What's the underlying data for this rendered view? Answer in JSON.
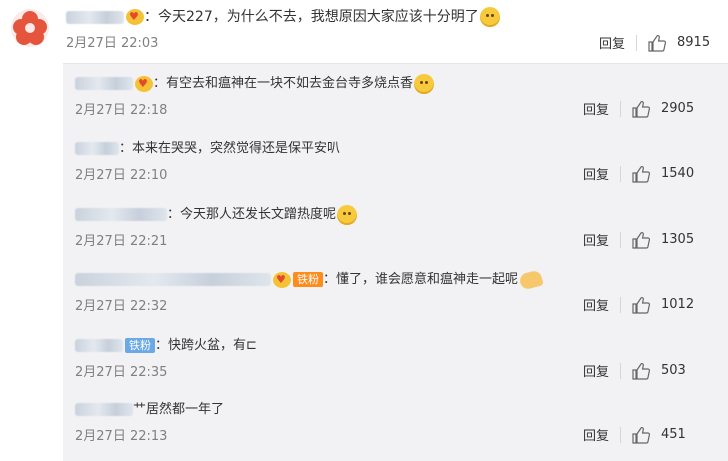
{
  "main_comment": {
    "text": "：今天227，为什么不去，我想原因大家应该十分明了",
    "time": "2月27日 22:03",
    "reply_label": "回复",
    "likes": "8915"
  },
  "replies": [
    {
      "text": "：有空去和瘟神在一块不如去金台寺多烧点香",
      "time": "2月27日 22:18",
      "reply_label": "回复",
      "likes": "2905"
    },
    {
      "text": "：本来在哭哭，突然觉得还是保平安叭",
      "time": "2月27日 22:10",
      "reply_label": "回复",
      "likes": "1540"
    },
    {
      "text": "：今天那人还发长文蹭热度呢",
      "time": "2月27日 22:21",
      "reply_label": "回复",
      "likes": "1305"
    },
    {
      "badge": "铁粉",
      "text": "：懂了，谁会愿意和瘟神走一起呢",
      "time": "2月27日 22:32",
      "reply_label": "回复",
      "likes": "1012"
    },
    {
      "badge": "铁粉",
      "text": "：快跨火盆，有⊏",
      "time": "2月27日 22:35",
      "reply_label": "回复",
      "likes": "503"
    },
    {
      "text": "艹居然都一年了",
      "time": "2月27日 22:13",
      "reply_label": "回复",
      "likes": "451"
    }
  ]
}
